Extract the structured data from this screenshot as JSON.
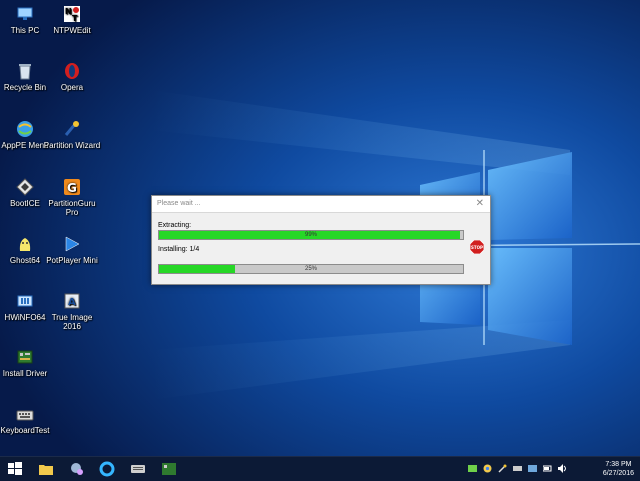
{
  "desktop": {
    "icons": [
      {
        "label": "This PC",
        "icon": "this-pc-icon"
      },
      {
        "label": "NTPWEdit",
        "icon": "ntpwedit-icon"
      },
      {
        "label": "Recycle Bin",
        "icon": "recycle-bin-icon"
      },
      {
        "label": "Opera",
        "icon": "opera-icon"
      },
      {
        "label": "AppPE Menu",
        "icon": "appe-menu-icon"
      },
      {
        "label": "Partition Wizard",
        "icon": "partition-wizard-icon"
      },
      {
        "label": "BootICE",
        "icon": "bootice-icon"
      },
      {
        "label": "PartitionGuru Pro",
        "icon": "partitionguru-icon"
      },
      {
        "label": "Ghost64",
        "icon": "ghost64-icon"
      },
      {
        "label": "PotPlayer Mini",
        "icon": "potplayer-icon"
      },
      {
        "label": "HWiNFO64",
        "icon": "hwinfo-icon"
      },
      {
        "label": "True Image 2016",
        "icon": "true-image-icon"
      },
      {
        "label": "Install Driver",
        "icon": "install-driver-icon"
      },
      {
        "label": "KeyboardTest",
        "icon": "keyboard-test-icon"
      }
    ]
  },
  "dialog": {
    "title": "Please wait ...",
    "close_glyph": "✕",
    "extracting_label": "Extracting:",
    "extracting_percent": "99%",
    "extracting_progress": 0.99,
    "installing_label": "Installing: 1/4",
    "installing_percent": "25%",
    "installing_progress": 0.25,
    "stop_label": "STOP"
  },
  "taskbar": {
    "time": "7:38 PM",
    "date": "6/27/2016"
  },
  "colors": {
    "progress_fill": "#26d726",
    "taskbar": "#0c1a36",
    "stop": "#d11f1f"
  }
}
